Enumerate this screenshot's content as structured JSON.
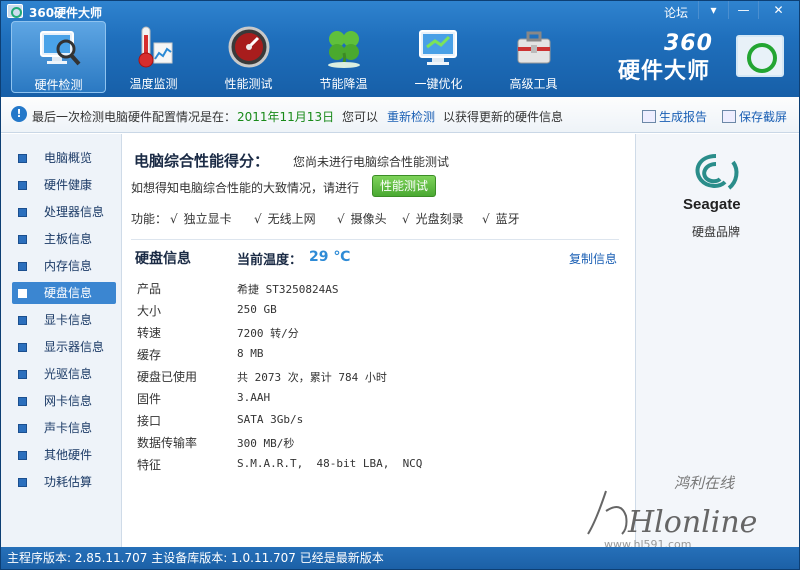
{
  "window": {
    "title": "360硬件大师",
    "forum": "论坛",
    "menu_glyph": "▾",
    "min_glyph": "—",
    "close_glyph": "✕"
  },
  "brand": {
    "line1": "360",
    "line2": "硬件大师"
  },
  "toolbar": [
    {
      "label": "硬件检测",
      "icon": "monitor-magnifier-icon",
      "active": true
    },
    {
      "label": "温度监测",
      "icon": "thermometer-icon",
      "active": false
    },
    {
      "label": "性能测试",
      "icon": "speedometer-icon",
      "active": false
    },
    {
      "label": "节能降温",
      "icon": "clover-icon",
      "active": false
    },
    {
      "label": "一键优化",
      "icon": "optimize-monitor-icon",
      "active": false
    },
    {
      "label": "高级工具",
      "icon": "toolbox-icon",
      "active": false
    }
  ],
  "infobar": {
    "text": "最后一次检测电脑硬件配置情况是在：",
    "date": "2011年11月13日",
    "you_can": "您可以",
    "recheck": "重新检测",
    "tail": "以获得更新的硬件信息",
    "report": "生成报告",
    "save": "保存截屏"
  },
  "sidebar": [
    {
      "label": "电脑概览"
    },
    {
      "label": "硬件健康"
    },
    {
      "label": "处理器信息"
    },
    {
      "label": "主板信息"
    },
    {
      "label": "内存信息"
    },
    {
      "label": "硬盘信息",
      "active": true
    },
    {
      "label": "显卡信息"
    },
    {
      "label": "显示器信息"
    },
    {
      "label": "光驱信息"
    },
    {
      "label": "网卡信息"
    },
    {
      "label": "声卡信息"
    },
    {
      "label": "其他硬件"
    },
    {
      "label": "功耗估算"
    }
  ],
  "score": {
    "title": "电脑综合性能得分：",
    "note": "您尚未进行电脑综合性能测试",
    "prompt": "如想得知电脑综合性能的大致情况，请进行",
    "button": "性能测试"
  },
  "features": {
    "label": "功能：",
    "check": "√",
    "items": [
      "独立显卡",
      "无线上网",
      "摄像头",
      "光盘刻录",
      "蓝牙"
    ]
  },
  "disk": {
    "title": "硬盘信息",
    "temp_label": "当前温度：",
    "temp_value": "29 ℃",
    "copy": "复制信息",
    "rows": [
      {
        "label": "产品",
        "value": "希捷 ST3250824AS"
      },
      {
        "label": "大小",
        "value": "250 GB"
      },
      {
        "label": "转速",
        "value": "7200 转/分"
      },
      {
        "label": "缓存",
        "value": "8 MB"
      },
      {
        "label": "硬盘已使用",
        "value": "共 2073 次，累计 784 小时"
      },
      {
        "label": "固件",
        "value": "3.AAH"
      },
      {
        "label": "接口",
        "value": "SATA 3Gb/s"
      },
      {
        "label": "数据传输率",
        "value": "300 MB/秒"
      },
      {
        "label": "特征",
        "value": "S.M.A.R.T,  48-bit LBA,  NCQ"
      }
    ]
  },
  "right_panel": {
    "brand_name": "Seagate",
    "caption": "硬盘品牌"
  },
  "watermark": {
    "cn": "鸿利在线",
    "en": "Hlonline",
    "url": "www.hl591.com"
  },
  "status": "主程序版本: 2.85.11.707  主设备库版本: 1.0.11.707  已经是最新版本",
  "colors": {
    "accent": "#1f6fbc",
    "link": "#1a5fb4",
    "date": "#198a1a",
    "button": "#4aa932",
    "temp": "#2e8bd6"
  }
}
